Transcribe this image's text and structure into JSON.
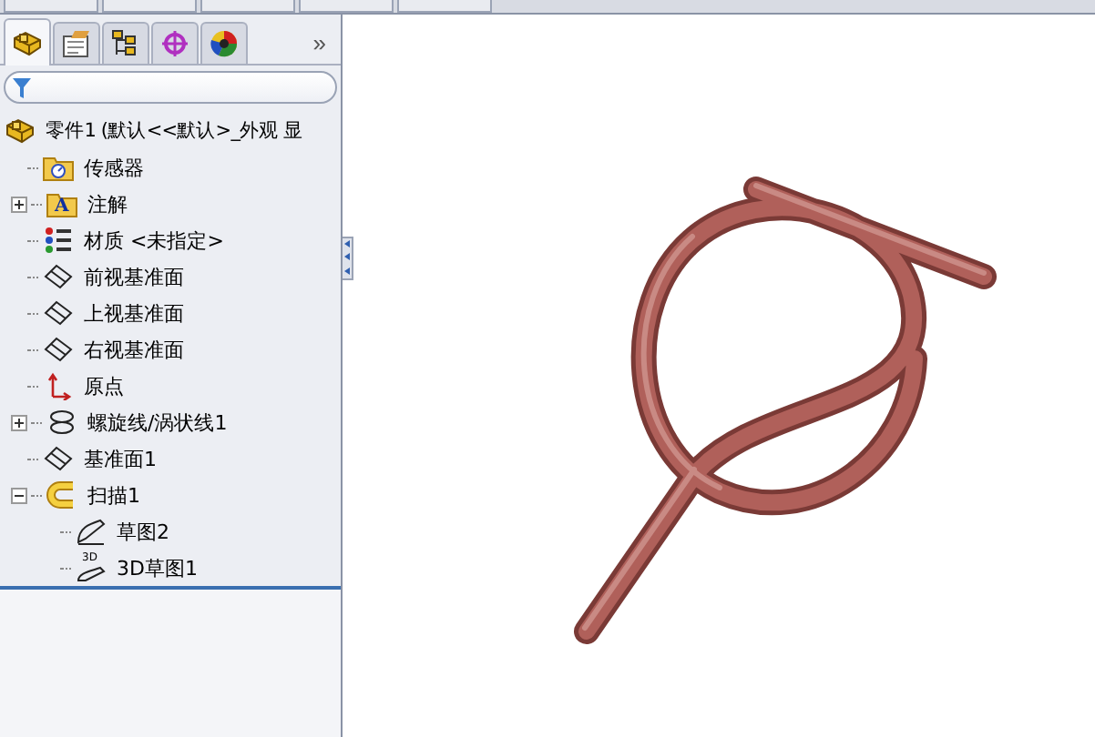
{
  "panel_tabs": [
    {
      "kind": "part",
      "selected": true
    },
    {
      "kind": "property",
      "selected": false
    },
    {
      "kind": "config",
      "selected": false
    },
    {
      "kind": "target",
      "selected": false
    },
    {
      "kind": "appearance",
      "selected": false
    }
  ],
  "more_tabs": "»",
  "tree": {
    "label": "零件1  (默认<<默认>_外观 显",
    "kind": "part",
    "children": [
      {
        "label": "传感器",
        "kind": "sensor"
      },
      {
        "label": "注解",
        "kind": "annotation",
        "icon_text": "A",
        "expanded": false
      },
      {
        "label": "材质 <未指定>",
        "kind": "material"
      },
      {
        "label": "前视基准面",
        "kind": "plane"
      },
      {
        "label": "上视基准面",
        "kind": "plane"
      },
      {
        "label": "右视基准面",
        "kind": "plane"
      },
      {
        "label": "原点",
        "kind": "origin"
      },
      {
        "label": "螺旋线/涡状线1",
        "kind": "helix",
        "expanded": false
      },
      {
        "label": "基准面1",
        "kind": "plane"
      },
      {
        "label": "扫描1",
        "kind": "sweep",
        "expanded": true,
        "children": [
          {
            "label": "草图2",
            "kind": "sketch"
          },
          {
            "label": "3D草图1",
            "kind": "sketch3d",
            "icon_text": "3D"
          }
        ]
      }
    ]
  }
}
